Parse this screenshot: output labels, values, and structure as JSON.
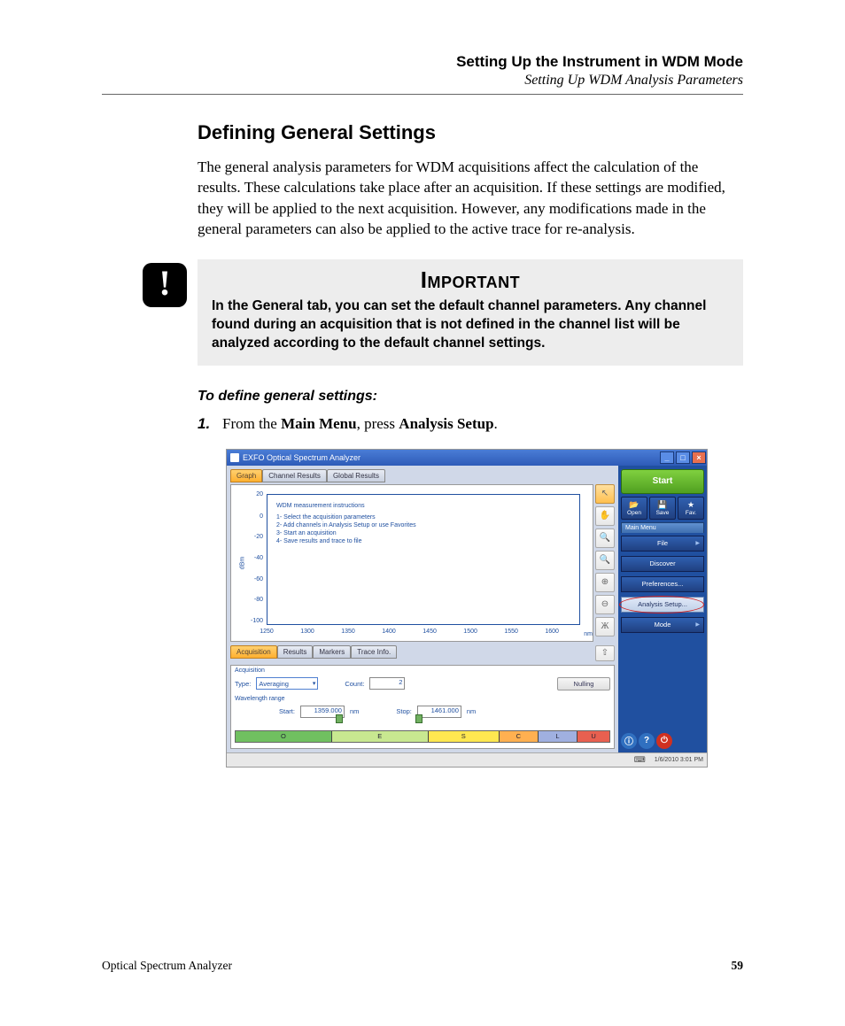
{
  "header": {
    "title": "Setting Up the Instrument in WDM Mode",
    "subtitle": "Setting Up WDM Analysis Parameters"
  },
  "section_heading": "Defining General Settings",
  "body_para": "The general analysis parameters for WDM acquisitions affect the calculation of the results. These calculations take place after an acquisition. If these settings are modified, they will be applied to the next acquisition. However, any modifications made in the general parameters can also be applied to the active trace for re-analysis.",
  "important": {
    "heading": "Important",
    "text": "In the General tab, you can set the default channel parameters. Any channel found during an acquisition that is not defined in the channel list will be analyzed according to the default channel settings."
  },
  "procedure_heading": "To define general settings:",
  "step1": {
    "num": "1.",
    "pre": "From the ",
    "b1": "Main Menu",
    "mid": ", press ",
    "b2": "Analysis Setup",
    "post": "."
  },
  "shot": {
    "window_title": "EXFO Optical Spectrum Analyzer",
    "tabs_top": {
      "graph": "Graph",
      "channel_results": "Channel Results",
      "global_results": "Global Results"
    },
    "graph": {
      "y_label": "dBm",
      "y_ticks": [
        "20",
        "0",
        "-20",
        "-40",
        "-60",
        "-80",
        "-100"
      ],
      "x_ticks": [
        "1250",
        "1300",
        "1350",
        "1400",
        "1450",
        "1500",
        "1550",
        "1600"
      ],
      "x_unit": "nm",
      "instr_title": "WDM measurement instructions",
      "instr_1": "1- Select the acquisition parameters",
      "instr_2": "2- Add channels in Analysis Setup or use Favorites",
      "instr_3": "3- Start an acquisition",
      "instr_4": "4- Save results and trace to file"
    },
    "tabs_bottom": {
      "acquisition": "Acquisition",
      "results": "Results",
      "markers": "Markers",
      "trace_info": "Trace Info."
    },
    "acq": {
      "legend": "Acquisition",
      "type_label": "Type:",
      "type_value": "Averaging",
      "count_label": "Count:",
      "count_value": "2",
      "nulling": "Nulling",
      "wl_legend": "Wavelength range",
      "start_label": "Start:",
      "start_value": "1359.000",
      "start_unit": "nm",
      "stop_label": "Stop:",
      "stop_value": "1461.000",
      "stop_unit": "nm",
      "bands": [
        "O",
        "E",
        "S",
        "C",
        "L",
        "U"
      ]
    },
    "side": {
      "start": "Start",
      "open": "Open",
      "save": "Save",
      "fav": "Fav.",
      "menu_header": "Main Menu",
      "file": "File",
      "discover": "Discover",
      "preferences": "Preferences...",
      "analysis_setup": "Analysis Setup...",
      "mode": "Mode"
    },
    "status": {
      "timestamp": "1/6/2010 3:01 PM"
    }
  },
  "footer": {
    "left": "Optical Spectrum Analyzer",
    "right": "59"
  },
  "chart_data": {
    "type": "line",
    "title": "WDM measurement instructions",
    "xlabel": "nm",
    "ylabel": "dBm",
    "x": [
      1250,
      1300,
      1350,
      1400,
      1450,
      1500,
      1550,
      1600
    ],
    "series": [],
    "ylim": [
      -100,
      20
    ],
    "xlim": [
      1250,
      1650
    ],
    "annotations": [
      "WDM measurement instructions",
      "1- Select the acquisition parameters",
      "2- Add channels in Analysis Setup or use Favorites",
      "3- Start an acquisition",
      "4- Save results and trace to file"
    ]
  }
}
